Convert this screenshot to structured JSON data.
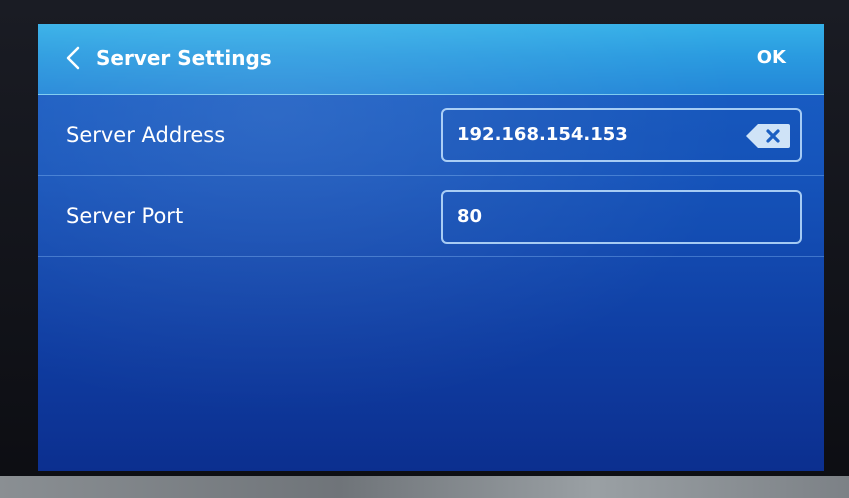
{
  "header": {
    "title": "Server Settings",
    "back_icon": "chevron-left-icon",
    "ok_label": "OK"
  },
  "settings": {
    "server_address": {
      "label": "Server Address",
      "value": "192.168.154.153",
      "clear_icon": "backspace-clear-icon"
    },
    "server_port": {
      "label": "Server Port",
      "value": "80"
    }
  },
  "colors": {
    "header_top": "#35b0e8",
    "screen_bg": "#1553ba",
    "text": "#ffffff"
  }
}
